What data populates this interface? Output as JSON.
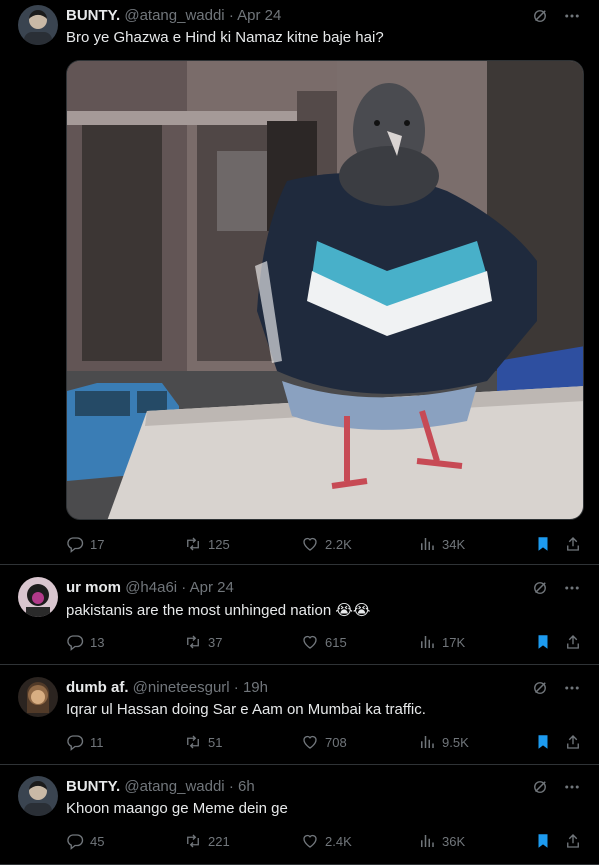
{
  "tweets": [
    {
      "name": "BUNTY.",
      "handle": "@atang_waddi",
      "time": "· Apr 24",
      "text": "Bro ye Ghazwa e Hind ki Namaz kitne baje hai?",
      "replies": "17",
      "reposts": "125",
      "likes": "2.2K",
      "views": "34K",
      "image_alt": "pigeon in a tracksuit jacket"
    },
    {
      "name": "ur mom",
      "handle": "@h4a6i",
      "time": "· Apr 24",
      "text": "pakistanis are the most unhinged nation 😭😭",
      "replies": "13",
      "reposts": "37",
      "likes": "615",
      "views": "17K"
    },
    {
      "name": "dumb af.",
      "handle": "@nineteesgurl",
      "time": "· 19h",
      "text": "Iqrar ul Hassan doing Sar e Aam on Mumbai ka traffic.",
      "replies": "11",
      "reposts": "51",
      "likes": "708",
      "views": "9.5K"
    },
    {
      "name": "BUNTY.",
      "handle": "@atang_waddi",
      "time": "· 6h",
      "text": "Khoon maango ge Meme dein ge",
      "replies": "45",
      "reposts": "221",
      "likes": "2.4K",
      "views": "36K"
    }
  ],
  "colors": {
    "background": "#000000",
    "text": "#e7e9ea",
    "muted": "#71767b",
    "bookmark": "#1d9bf0",
    "divider": "#2f3336"
  }
}
